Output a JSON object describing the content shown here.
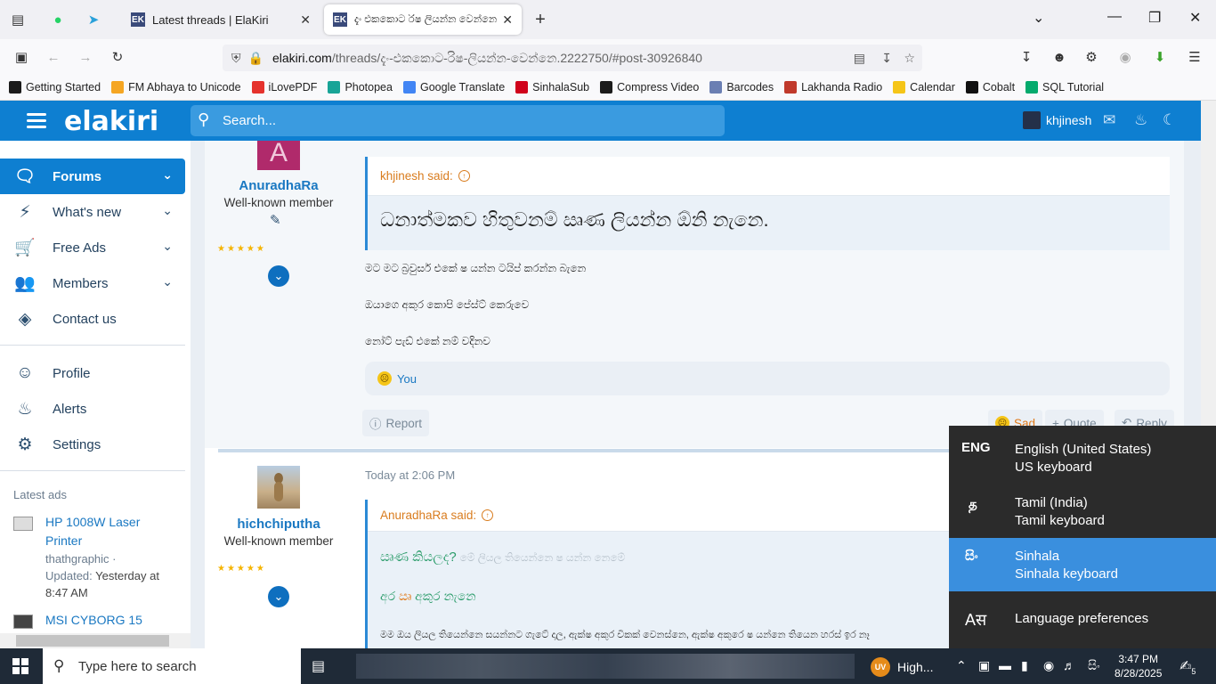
{
  "browser": {
    "tabs": [
      {
        "title": "Latest threads | ElaKiri"
      },
      {
        "title": "දැං එකකොට රිෂ ලියන්න වෙන්නෙ"
      }
    ],
    "url_host": "elakiri.com",
    "url_path": "/threads/දැං-එකකොට-රිෂ-ලියන්න-වෙන්නෙ.2222750/#post-30926840",
    "bookmarks": [
      {
        "label": "Getting Started",
        "color": "#1b1b1b"
      },
      {
        "label": "FM Abhaya to Unicode",
        "color": "#f5a623"
      },
      {
        "label": "iLovePDF",
        "color": "#e5322d"
      },
      {
        "label": "Photopea",
        "color": "#18a497"
      },
      {
        "label": "Google Translate",
        "color": "#4285f4"
      },
      {
        "label": "SinhalaSub",
        "color": "#d0021b"
      },
      {
        "label": "Compress Video",
        "color": "#1b1b1b"
      },
      {
        "label": "Barcodes",
        "color": "#6b7fb3"
      },
      {
        "label": "Lakhanda Radio",
        "color": "#c0392b"
      },
      {
        "label": "Calendar",
        "color": "#f5c518"
      },
      {
        "label": "Cobalt",
        "color": "#111111"
      },
      {
        "label": "SQL Tutorial",
        "color": "#04aa6d"
      }
    ]
  },
  "site": {
    "logo": "elakiri",
    "search_placeholder": "Search...",
    "username": "khjinesh",
    "accent": "#0e7fd1"
  },
  "sidebar": {
    "nav": [
      {
        "label": "Forums",
        "icon": "chat-icon"
      },
      {
        "label": "What's new",
        "icon": "bolt-icon"
      },
      {
        "label": "Free Ads",
        "icon": "cart-icon"
      },
      {
        "label": "Members",
        "icon": "users-icon"
      },
      {
        "label": "Contact us",
        "icon": "compass-icon"
      }
    ],
    "account": [
      {
        "label": "Profile",
        "icon": "user-icon"
      },
      {
        "label": "Alerts",
        "icon": "bell-icon"
      },
      {
        "label": "Settings",
        "icon": "gear-icon"
      }
    ],
    "latest_ads_title": "Latest ads",
    "ads": [
      {
        "title": "HP 1008W Laser Printer",
        "seller": "thathgraphic ·",
        "updated_label": "Updated:",
        "updated_value": "Yesterday at 8:47 AM"
      },
      {
        "title": "MSI CYBORG 15"
      }
    ]
  },
  "posts": [
    {
      "avatar_letter": "A",
      "username": "AnuradhaRa",
      "user_title": "Well-known member",
      "quote_author": "khjinesh said:",
      "quote_text": "ධනාත්මකව හිතුවනම් ඍණ ලියන්න ඕනි නැනෙ.",
      "body": [
        "මට මට බ්‍රවුසර් එකේ ෂ යන්න ටයිප් කරන්න බැනෙ",
        "ඔයාගෙ අකුර කොපි පේස්ට් කෙරුවෙ",
        "නෝට් පැඩ් එකේ නම් වදිනව"
      ],
      "reaction_label": "You",
      "report_label": "Report",
      "sad_label": "Sad",
      "quote_label": "Quote",
      "reply_label": "Reply"
    },
    {
      "username": "hichchiputha",
      "user_title": "Well-known member",
      "timestamp": "Today at 2:06 PM",
      "quote_author": "AnuradhaRa said:",
      "line1_green": "ඍණ කියලද?",
      "line1_grey": "මේ ලියල තියෙන්නෙ ෂ යන්න නෙමේ",
      "line2_green_a": "අර",
      "line2_orange": "ඍ",
      "line2_green_b": "අකුර නැනෙ",
      "line3": "මම ඔය ලියල තියෙන්නෙ සයන්නට ගැටේ දාල, ඇක්ෂ අකුර විකක් වෙනස්නෙ, ඇක්ෂ අකුරෙ ෂ යන්නෙ තියෙන හරස් ඉර නෑ"
    }
  ],
  "language_flyout": {
    "items": [
      {
        "code": "ENG",
        "name": "English (United States)",
        "keyboard": "US keyboard"
      },
      {
        "code": "த",
        "name": "Tamil (India)",
        "keyboard": "Tamil keyboard"
      },
      {
        "code": "සිං",
        "name": "Sinhala",
        "keyboard": "Sinhala keyboard"
      }
    ],
    "preferences_label": "Language preferences",
    "active_color": "#3a8fde"
  },
  "taskbar": {
    "search_placeholder": "Type here to search",
    "tray_app_label": "High...",
    "tray_app_badge": "UV",
    "input_indicator": "සිං",
    "time": "3:47 PM",
    "date": "8/28/2025",
    "notification_count": "5"
  }
}
